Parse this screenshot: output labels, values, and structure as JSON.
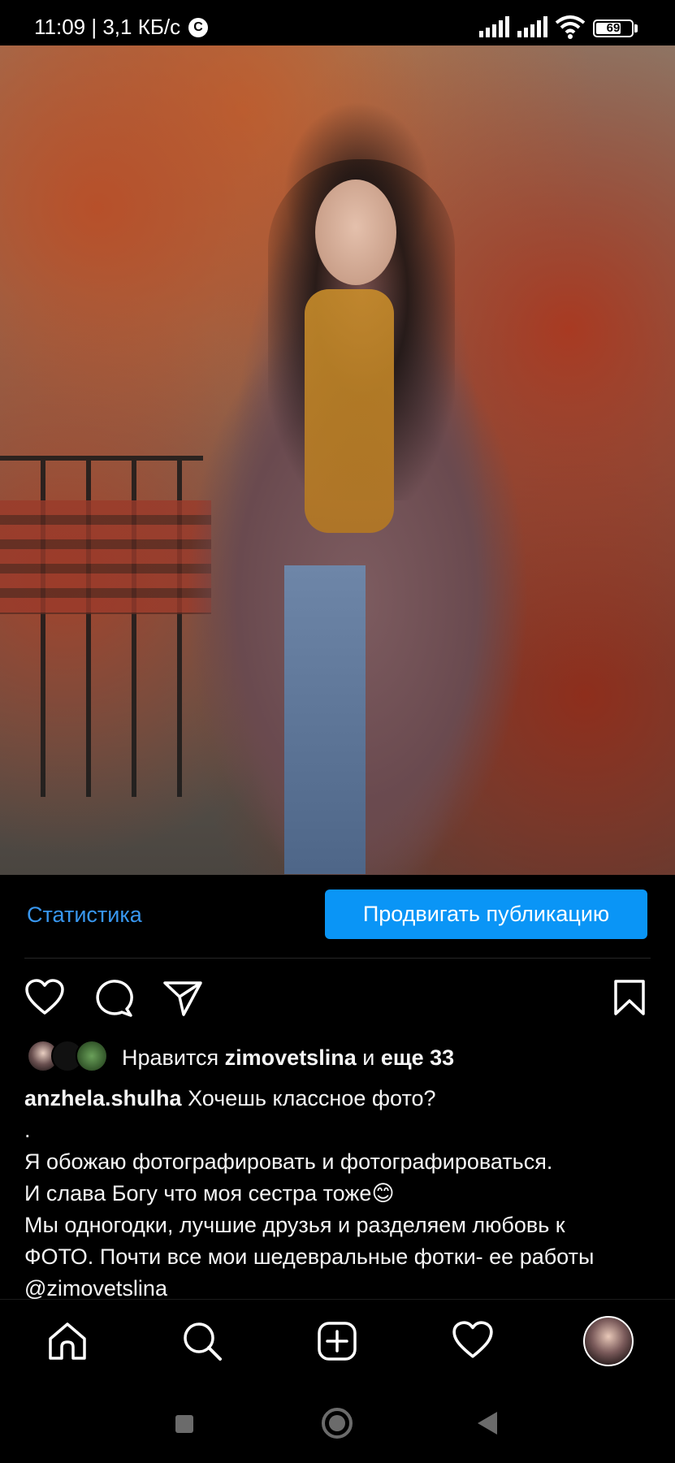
{
  "status_bar": {
    "time_speed": "11:09 | 3,1 КБ/с",
    "carrier_icon_letter": "C",
    "battery": "69"
  },
  "post": {
    "actions": {
      "stats_label": "Статистика",
      "promote_label": "Продвигать публикацию"
    },
    "likes": {
      "prefix": "Нравится ",
      "user": "zimovetslina",
      "joiner": " и ",
      "others": "еще 33"
    },
    "caption": {
      "username": "anzhela.shulha",
      "first_line": " Хочешь классное фото?",
      "lines": [
        ".",
        "Я обожаю фотографировать и фотографироваться.",
        "И слава Богу что моя сестра тоже😊",
        "Мы одногодки, лучшие друзья и разделяем любовь к",
        "ФОТО. Почти все мои шедевральные фотки- ее работы",
        "@zimovetslina"
      ]
    }
  },
  "icons": {
    "like": "heart-icon",
    "comment": "comment-icon",
    "share": "send-icon",
    "save": "bookmark-icon"
  },
  "bottom_nav": [
    "home-icon",
    "search-icon",
    "new-post-icon",
    "activity-heart-icon",
    "profile-avatar"
  ],
  "colors": {
    "link_blue": "#3897f0",
    "button_blue": "#0a95f6",
    "background": "#000000"
  }
}
